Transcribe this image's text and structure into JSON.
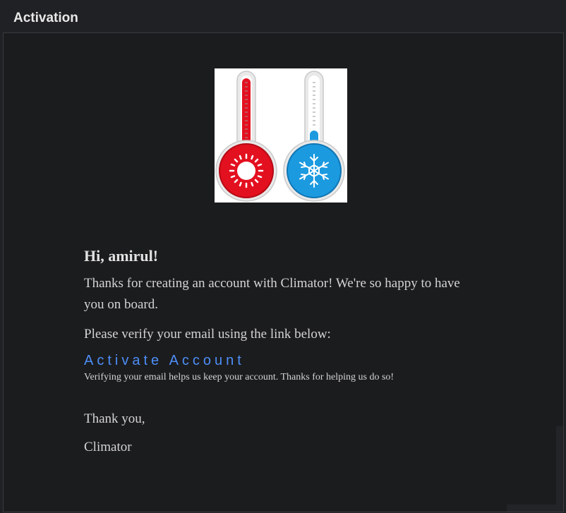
{
  "header": {
    "title": "Activation"
  },
  "logo": {
    "icon": "thermometers-hot-cold-icon",
    "hot_color": "#e3101f",
    "cold_color": "#1b9ae0"
  },
  "email": {
    "greeting": "Hi, amirul!",
    "intro": "Thanks for creating an account with Climator! We're so happy to have you on board.",
    "verify_prompt": "Please verify your email using the link below:",
    "activate_link_label": "Activate Account",
    "note": "Verifying your email helps us keep your account. Thanks for helping us do so!",
    "closing": "Thank you,",
    "signature": "Climator"
  },
  "colors": {
    "link": "#4d8ef7",
    "background": "#1b1c1e"
  }
}
